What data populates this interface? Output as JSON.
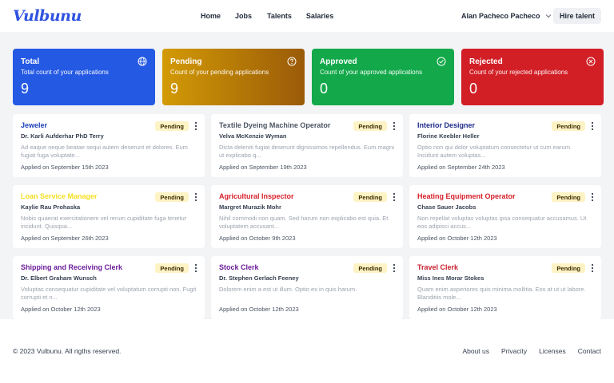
{
  "header": {
    "logo": "Vulbunu",
    "nav": [
      "Home",
      "Jobs",
      "Talents",
      "Salaries"
    ],
    "user_name": "Alan Pacheco Pacheco",
    "hire_label": "Hire talent"
  },
  "stats": [
    {
      "title": "Total",
      "desc": "Total count of your applications",
      "value": "9",
      "icon": "globe-icon",
      "color": "#2459e4"
    },
    {
      "title": "Pending",
      "desc": "Count of your pending applications",
      "value": "9",
      "icon": "question-icon",
      "color": "#c07d06"
    },
    {
      "title": "Approved",
      "desc": "Count of your approved applications",
      "value": "0",
      "icon": "check-circle-icon",
      "color": "#13a94a"
    },
    {
      "title": "Rejected",
      "desc": "Count of your rejected applications",
      "value": "0",
      "icon": "x-circle-icon",
      "color": "#d21f26"
    }
  ],
  "cards": [
    {
      "title": "Jeweler",
      "color": "#1e3fb8",
      "person": "Dr. Karli Aufderhar PhD Terry",
      "desc": "Ad eaque neque beatae sequi autem deserunt et dolores. Eum fugiat fuga voluptate...",
      "date": "Applied on September 15th 2023",
      "status": "Pending"
    },
    {
      "title": "Textile Dyeing Machine Operator",
      "color": "#4b5563",
      "person": "Velva McKenzie Wyman",
      "desc": "Dicta deleniti fugiat deserunt dignissimos repellendus. Eum magni ut explicabo q...",
      "date": "Applied on September 19th 2023",
      "status": "Pending"
    },
    {
      "title": "Interior Designer",
      "color": "#1e2a8a",
      "person": "Florine Keebler Heller",
      "desc": "Optio non qui dolor voluptatum consectetur ut cum earum. Incidunt autem voluptas...",
      "date": "Applied on September 24th 2023",
      "status": "Pending"
    },
    {
      "title": "Loan Service Manager",
      "color": "#f4df1f",
      "person": "Kaylie Rau Prohaska",
      "desc": "Nobis quaerat exercitationem vel rerum cupiditate fuga tenetur incidunt. Quisqua...",
      "date": "Applied on September 26th 2023",
      "status": "Pending"
    },
    {
      "title": "Agricultural Inspector",
      "color": "#d6202a",
      "person": "Margret Murazik Mohr",
      "desc": "Nihil commodi non quam. Sed harum non explicabo est quia. Et voluptatem accusant...",
      "date": "Applied on October 9th 2023",
      "status": "Pending"
    },
    {
      "title": "Heating Equipment Operator",
      "color": "#d6202a",
      "person": "Chase Sauer Jacobs",
      "desc": "Non repellat voluptas voluptas ipsa consequatur accusamus. Ut eos adipisci accus...",
      "date": "Applied on October 12th 2023",
      "status": "Pending"
    },
    {
      "title": "Shipping and Receiving Clerk",
      "color": "#6b1c98",
      "person": "Dr. Elbert Graham Wunsch",
      "desc": "Voluptas consequatur cupiditate vel voluptatum corrupti non. Fugit corrupti et n...",
      "date": "Applied on October 12th 2023",
      "status": "Pending"
    },
    {
      "title": "Stock Clerk",
      "color": "#6b1c98",
      "person": "Dr. Stephen Gerlach Feeney",
      "desc": "Dolorem enim a est ut illum. Optio ex in quis harum.",
      "date": "Applied on October 12th 2023",
      "status": "Pending"
    },
    {
      "title": "Travel Clerk",
      "color": "#c81e2c",
      "person": "Miss Ines Morar Stokes",
      "desc": "Quam enim asperiores quis minima mollitia. Eos at ut ut labore. Blanditiis mole...",
      "date": "Applied on October 12th 2023",
      "status": "Pending"
    }
  ],
  "footer": {
    "copyright": "© 2023 Vulbunu. All rigths reserved.",
    "links": [
      "About us",
      "Privacity",
      "Licenses",
      "Contact"
    ]
  }
}
